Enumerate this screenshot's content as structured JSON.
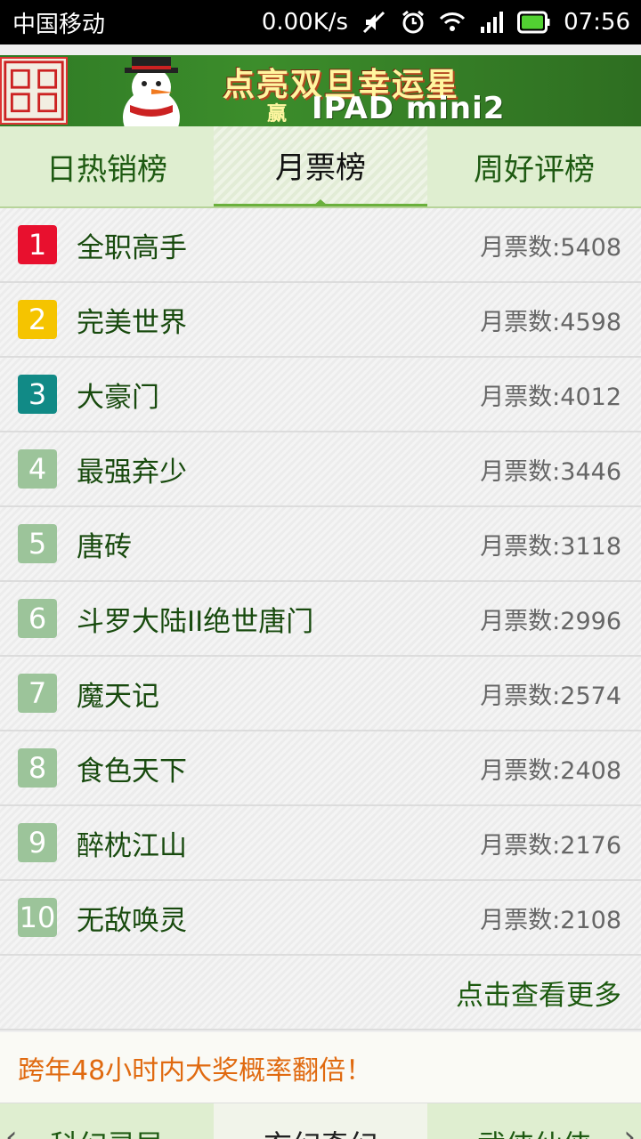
{
  "status": {
    "carrier": "中国移动",
    "speed": "0.00K/s",
    "time": "07:56"
  },
  "banner": {
    "logo_text": "起点中文网",
    "line1": "点亮双旦幸运星",
    "line2_prefix": "赢",
    "line2": "IPAD mini2"
  },
  "tabs": [
    {
      "label": "日热销榜"
    },
    {
      "label": "月票榜"
    },
    {
      "label": "周好评榜"
    }
  ],
  "list": [
    {
      "rank": "1",
      "title": "全职高手",
      "votes": "月票数:5408",
      "color": "#e8102e"
    },
    {
      "rank": "2",
      "title": "完美世界",
      "votes": "月票数:4598",
      "color": "#f5c400"
    },
    {
      "rank": "3",
      "title": "大豪门",
      "votes": "月票数:4012",
      "color": "#118a86"
    },
    {
      "rank": "4",
      "title": "最强弃少",
      "votes": "月票数:3446",
      "color": "#9cc49a"
    },
    {
      "rank": "5",
      "title": "唐砖",
      "votes": "月票数:3118",
      "color": "#9cc49a"
    },
    {
      "rank": "6",
      "title": "斗罗大陆II绝世唐门",
      "votes": "月票数:2996",
      "color": "#9cc49a"
    },
    {
      "rank": "7",
      "title": "魔天记",
      "votes": "月票数:2574",
      "color": "#9cc49a"
    },
    {
      "rank": "8",
      "title": "食色天下",
      "votes": "月票数:2408",
      "color": "#9cc49a"
    },
    {
      "rank": "9",
      "title": "醉枕江山",
      "votes": "月票数:2176",
      "color": "#9cc49a"
    },
    {
      "rank": "10",
      "title": "无敌唤灵",
      "votes": "月票数:2108",
      "color": "#9cc49a"
    }
  ],
  "more": "点击查看更多",
  "promo": "跨年48小时内大奖概率翻倍！",
  "bottom_tabs": [
    {
      "label": "科幻灵异"
    },
    {
      "label": "玄幻奇幻"
    },
    {
      "label": "武侠仙侠"
    }
  ],
  "icons": {
    "mute": "mute-icon",
    "alarm": "alarm-icon",
    "wifi": "wifi-icon",
    "signal": "signal-icon",
    "battery": "battery-icon"
  }
}
